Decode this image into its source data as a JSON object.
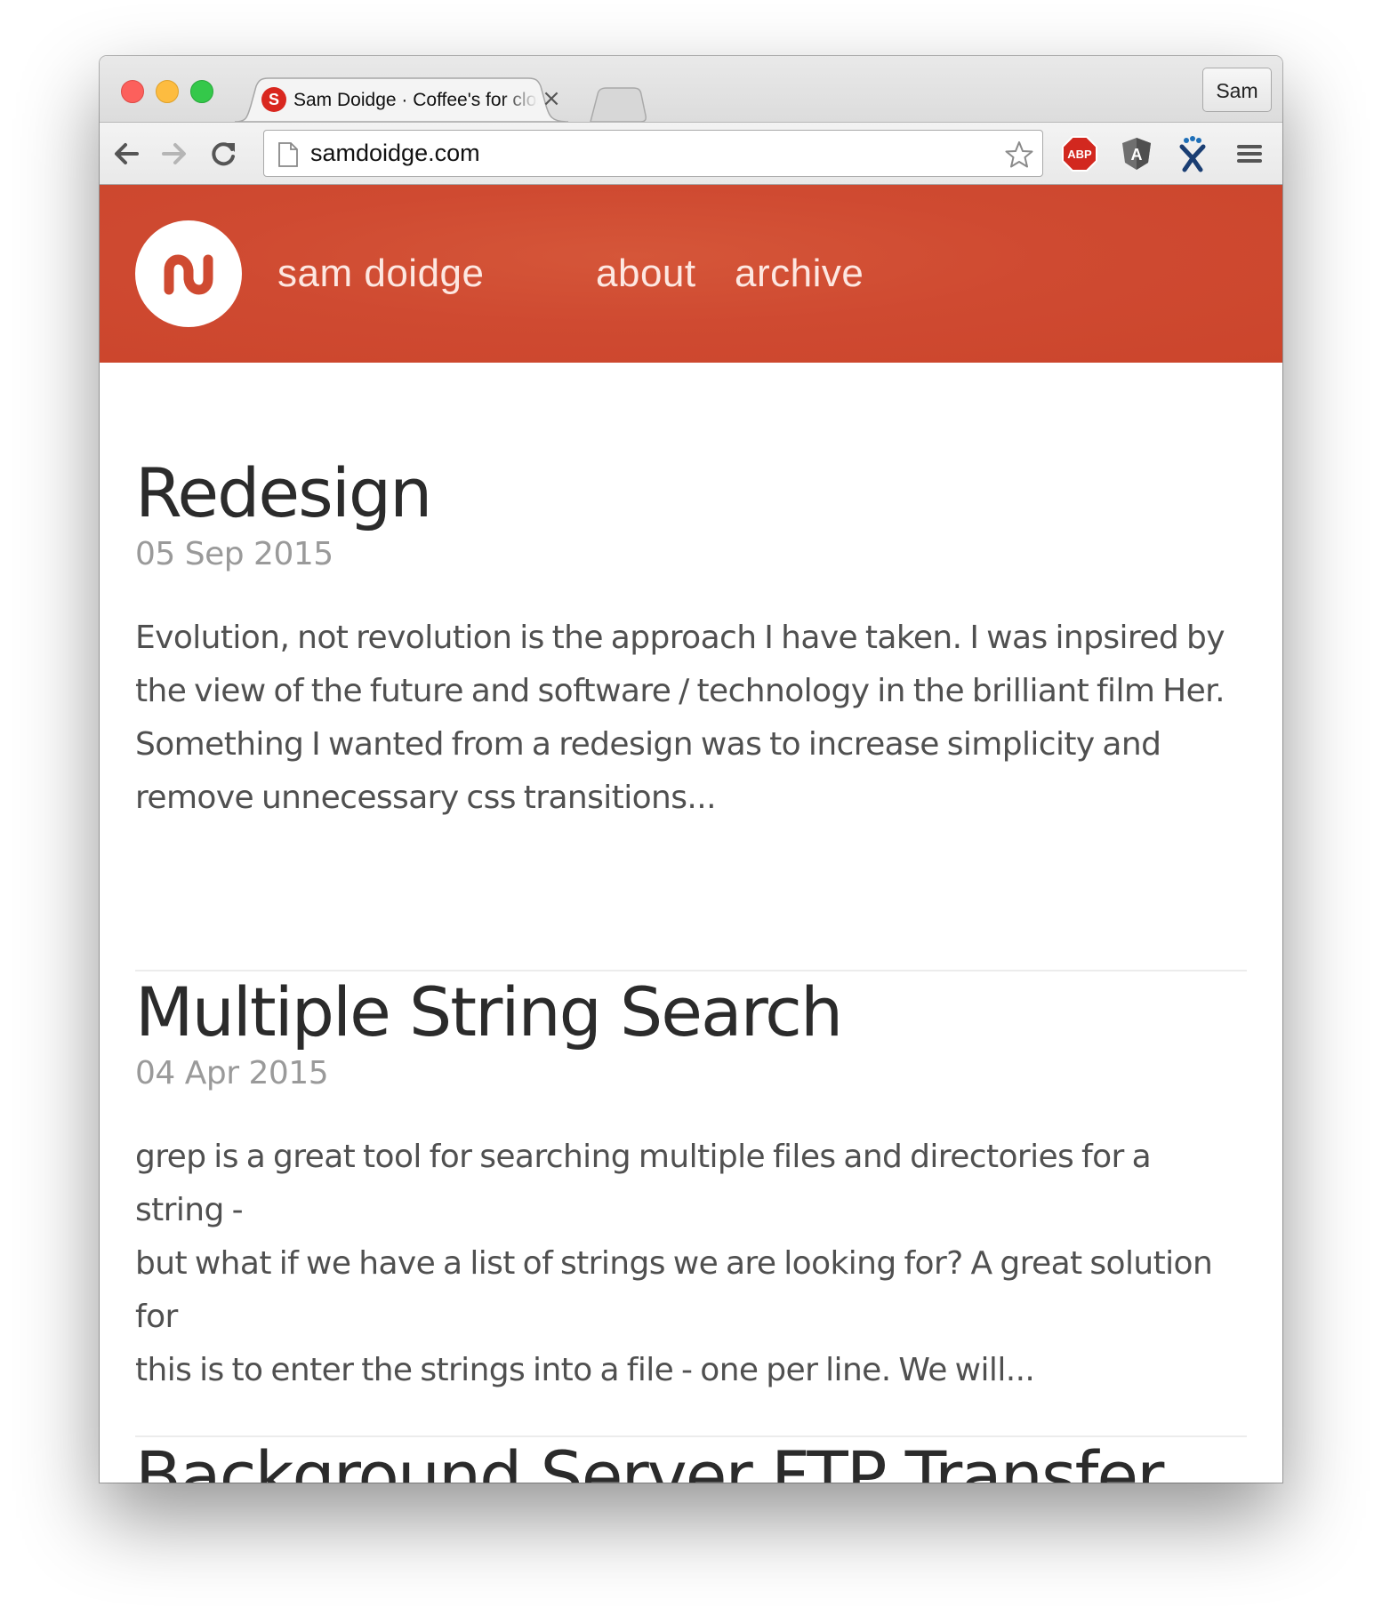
{
  "browser": {
    "tab": {
      "favicon_letter": "S",
      "title": "Sam Doidge · Coffee's for closers",
      "close_glyph": "×"
    },
    "profile": "Sam",
    "url": "samdoidge.com",
    "extensions": [
      "abp-icon",
      "angular-icon",
      "jenkins-icon"
    ],
    "extension_labels": {
      "abp": "ABP",
      "angular": "A"
    }
  },
  "site": {
    "name": "sam doidge",
    "nav": [
      "about",
      "archive"
    ],
    "accent_color": "#cf4a31"
  },
  "posts": [
    {
      "title": "Redesign",
      "date": "05 Sep 2015",
      "excerpt_lines": [
        "Evolution, not revolution is the approach I have taken. I was inpsired by",
        "the view of the future and software / technology in the brilliant film Her.",
        "Something I wanted from a redesign was to increase simplicity and",
        "remove unnecessary css transitions..."
      ]
    },
    {
      "title": "Multiple String Search",
      "date": "04 Apr 2015",
      "excerpt_lines": [
        "grep is a great tool for searching multiple files and directories for a string -",
        "but what if we have a list of strings we are looking for? A great solution for",
        "this is to enter the strings into a file - one per line. We will..."
      ]
    },
    {
      "title": "Background Server FTP Transfer"
    }
  ]
}
